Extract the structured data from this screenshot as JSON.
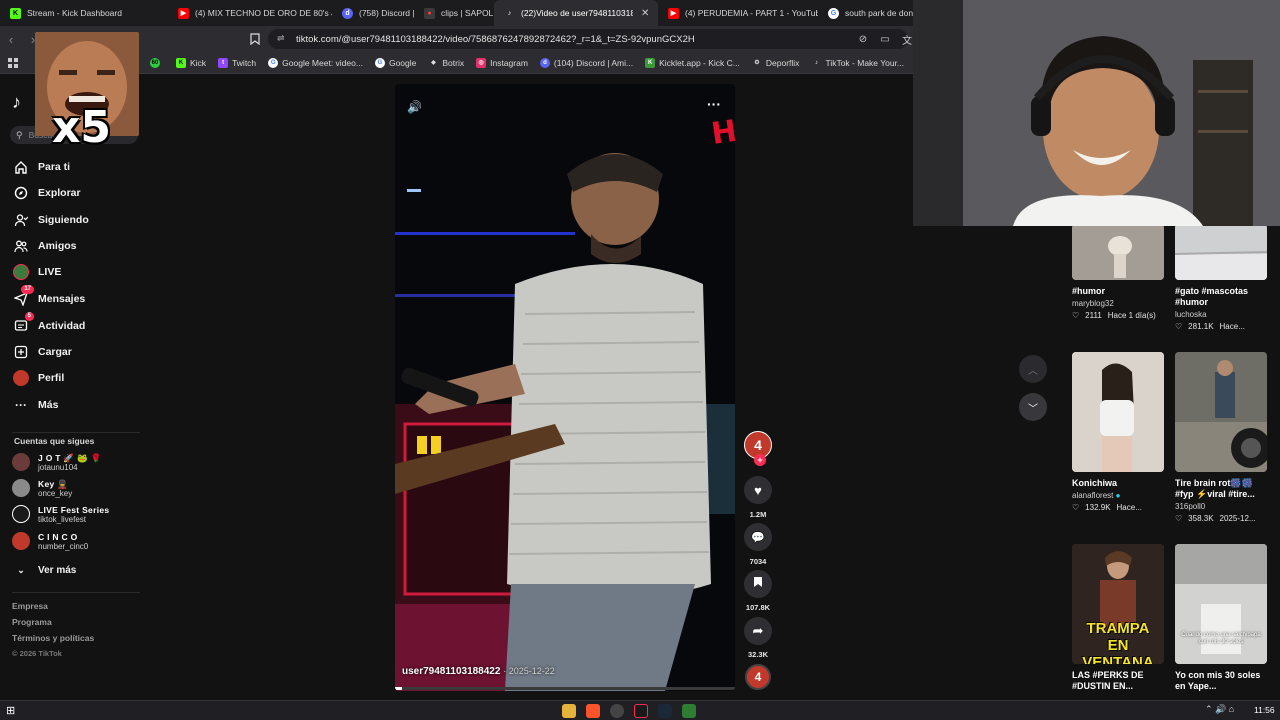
{
  "browser": {
    "tabs": [
      {
        "title": "Stream - Kick Dashboard",
        "icon": "kick-icon",
        "color": "#53fc18"
      },
      {
        "title": "(4) MIX TECHNO DE ORO DE 80's & 9",
        "icon": "youtube-icon",
        "color": "#ff0000"
      },
      {
        "title": "(758) Discord | #T",
        "icon": "discord-icon",
        "color": "#5865f2"
      },
      {
        "title": "clips | SAPOLIC",
        "icon": "clips-icon",
        "color": "#ff3b3b"
      },
      {
        "title": "(22)Video de user79481103188",
        "icon": "tiktok-icon",
        "color": "#ffffff",
        "active": true
      },
      {
        "title": "(4) PERUDEMIA - PART 1 - YouTube",
        "icon": "youtube-icon",
        "color": "#ff0000"
      },
      {
        "title": "south park de dond",
        "icon": "google-icon",
        "color": "#4285f4"
      }
    ],
    "url": "tiktok.com/@user79481103188422/video/7586876247892872462?_r=1&_t=ZS-92vpunGCX2H",
    "bookmarks": [
      {
        "label": "",
        "icon": "green-icon",
        "color": "#2ecc40"
      },
      {
        "label": "Kick",
        "icon": "kick-icon",
        "color": "#53fc18"
      },
      {
        "label": "Twitch",
        "icon": "twitch-icon",
        "color": "#9146ff"
      },
      {
        "label": "Google Meet: video...",
        "icon": "google-icon",
        "color": "#4285f4"
      },
      {
        "label": "Google",
        "icon": "google-icon",
        "color": "#4285f4"
      },
      {
        "label": "Botrix",
        "icon": "botrix-icon",
        "color": "#cccccc"
      },
      {
        "label": "Instagram",
        "icon": "instagram-icon",
        "color": "#e1306c"
      },
      {
        "label": "(104) Discord | Ami...",
        "icon": "discord-icon",
        "color": "#5865f2"
      },
      {
        "label": "Kicklet.app - Kick C...",
        "icon": "kicklet-icon",
        "color": "#3a9a3a"
      },
      {
        "label": "Deporflix",
        "icon": "gear-icon",
        "color": "#cccccc"
      },
      {
        "label": "TikTok - Make Your...",
        "icon": "tiktok-icon",
        "color": "#ffffff"
      }
    ]
  },
  "overlay": {
    "multiplier": "x5"
  },
  "sidebar": {
    "search_placeholder": "Buscar",
    "items": [
      {
        "label": "Para ti",
        "icon": "home-icon"
      },
      {
        "label": "Explorar",
        "icon": "compass-icon"
      },
      {
        "label": "Siguiendo",
        "icon": "following-icon"
      },
      {
        "label": "Amigos",
        "icon": "friends-icon"
      },
      {
        "label": "LIVE",
        "icon": "live-icon"
      },
      {
        "label": "Mensajes",
        "icon": "messages-icon",
        "badge": "17"
      },
      {
        "label": "Actividad",
        "icon": "activity-icon",
        "badge": "5"
      },
      {
        "label": "Cargar",
        "icon": "upload-icon"
      },
      {
        "label": "Perfil",
        "icon": "profile-icon"
      },
      {
        "label": "Más",
        "icon": "more-icon"
      }
    ],
    "following_title": "Cuentas que sigues",
    "following": [
      {
        "name": "J O T 🚀 🐸 🌹",
        "user": "jotaunu104",
        "color": "#6b3a3a"
      },
      {
        "name": "Key 💂",
        "user": "once_key",
        "color": "#8a8a8a"
      },
      {
        "name": "LIVE Fest Series",
        "user": "tiktok_livefest",
        "color": "#1a1a1a"
      },
      {
        "name": "C I N C O",
        "user": "number_cinc0",
        "color": "#c0392b"
      }
    ],
    "see_more": "Ver más",
    "footer": [
      "Empresa",
      "Programa",
      "Términos y políticas",
      "© 2026 TikTok"
    ]
  },
  "video": {
    "author": "user79481103188422",
    "date": "2025-12-22",
    "likes": "1.2M",
    "comments": "7034",
    "saves": "107.8K",
    "shares": "32.3K",
    "progress": 0.02
  },
  "recommendations": [
    {
      "caption": "#humor",
      "author": "maryblog32",
      "likes": "2111",
      "age": "Hace 1 día(s)",
      "color": "#9a9a9a"
    },
    {
      "caption": "#gato #mascotas #humor",
      "author": "luchoska",
      "likes": "281.1K",
      "age": "Hace...",
      "color": "#d9d9d9"
    },
    {
      "caption": "Konichiwa",
      "author": "alanaflorest",
      "likes": "132.9K",
      "age": "Hace...",
      "color": "#d7cfc7",
      "verified": true
    },
    {
      "caption": "Tire brain rot🎆🎆 #fyp ⚡viral #tire...",
      "author": "316poll0",
      "likes": "358.3K",
      "age": "2025-12...",
      "color": "#6e6e66"
    },
    {
      "caption": "LAS #PERKS DE #DUSTIN EN...",
      "author": "",
      "likes": "",
      "age": "",
      "color": "#3b2a25",
      "overlay": "TRAMPA EN VENTANA"
    },
    {
      "caption": "Yo con mis 30 soles en Yape...",
      "author": "",
      "likes": "",
      "age": "",
      "color": "#cfcfcf",
      "overlay": "Cuando como una salchipapa con mis 30 soles"
    }
  ],
  "taskbar": {
    "time": "11:56"
  }
}
